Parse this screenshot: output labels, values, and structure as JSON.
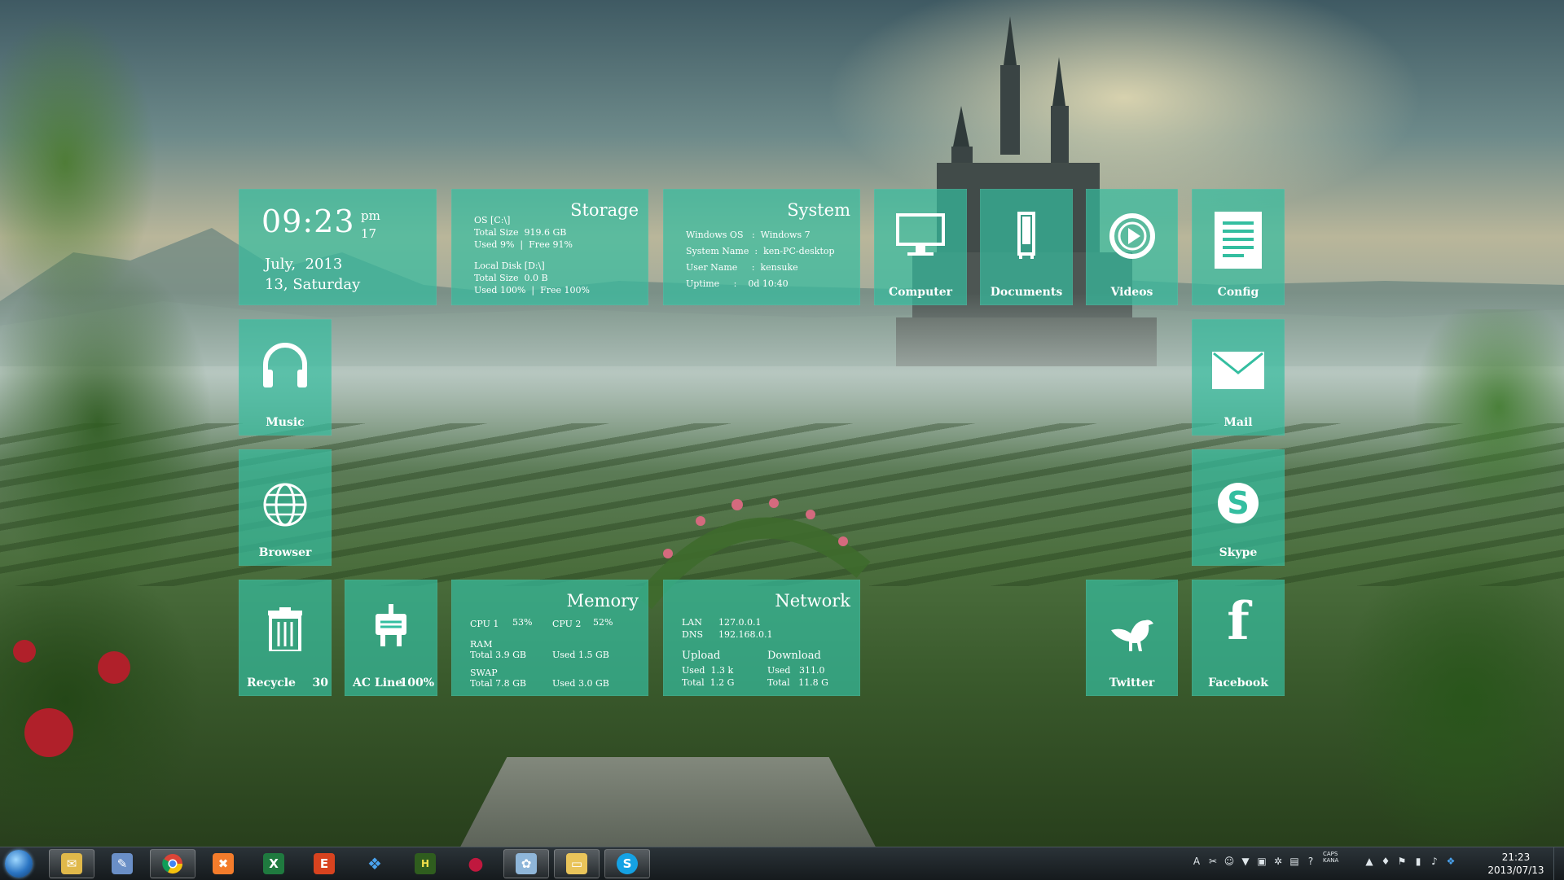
{
  "clock": {
    "time": "09:23",
    "ampm": "pm",
    "seconds": "17",
    "month_year": "July,  2013",
    "day": "13, Saturday"
  },
  "storage": {
    "title": "Storage",
    "os_line": "OS [C:\\]",
    "os_total": "Total Size  919.6 GB",
    "os_used": "Used 9%  |  Free 91%",
    "local_line": "Local Disk [D:\\]",
    "local_total": "Total Size  0.0 B",
    "local_used": "Used 100%  |  Free 100%"
  },
  "system": {
    "title": "System",
    "rows": [
      "Windows OS   :  Windows 7",
      "System Name  :  ken-PC-desktop",
      "User Name     :  kensuke",
      "Uptime     :    0d 10:40"
    ]
  },
  "tiles": {
    "computer": "Computer",
    "documents": "Documents",
    "videos": "Videos",
    "config": "Config",
    "music": "Music",
    "mail": "Mail",
    "browser": "Browser",
    "skype": "Skype",
    "recycle": "Recycle",
    "recycle_count": "30",
    "acline": "AC Line",
    "acline_value": "100%",
    "twitter": "Twitter",
    "facebook": "Facebook"
  },
  "memory": {
    "title": "Memory",
    "cpu1_label": "CPU 1",
    "cpu1_value": "53%",
    "cpu2_label": "CPU 2",
    "cpu2_value": "52%",
    "ram_label": "RAM",
    "ram_total": "Total 3.9 GB",
    "ram_used": "Used 1.5 GB",
    "swap_label": "SWAP",
    "swap_total": "Total 7.8 GB",
    "swap_used": "Used 3.0 GB"
  },
  "network": {
    "title": "Network",
    "lan_label": "LAN",
    "lan_value": "127.0.0.1",
    "dns_label": "DNS",
    "dns_value": "192.168.0.1",
    "upload_label": "Upload",
    "upload_used": "Used  1.3 k",
    "upload_total": "Total  1.2 G",
    "download_label": "Download",
    "download_used": "Used   311.0",
    "download_total": "Total   11.8 G"
  },
  "taskbar": {
    "apps": [
      "start-orb",
      "mail-icon",
      "write-icon",
      "chrome-icon",
      "xampp-icon",
      "excel-icon",
      "foxit-icon",
      "dropbox-icon",
      "club-icon",
      "drop-icon",
      "paint-icon",
      "explorer-icon",
      "skype-icon"
    ],
    "tray_clock_time": "21:23",
    "tray_clock_date": "2013/07/13",
    "tray_caps": "CAPS",
    "tray_kana": "KANA"
  },
  "colors": {
    "tile": "#34bea0",
    "taskbar": "#1c2326"
  }
}
